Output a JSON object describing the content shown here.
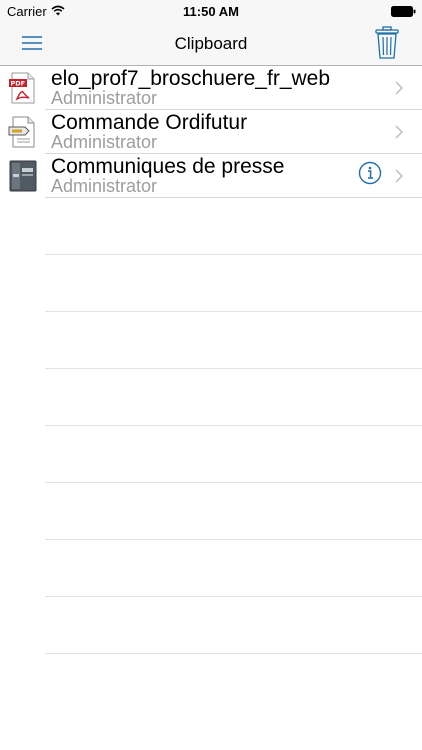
{
  "status_bar": {
    "carrier": "Carrier",
    "time": "11:50 AM",
    "wifi_icon": "wifi-icon",
    "battery_icon": "battery-icon"
  },
  "nav": {
    "title": "Clipboard",
    "menu_icon": "hamburger-menu-icon",
    "trash_icon": "trash-icon"
  },
  "colors": {
    "accent": "#1f6fa8",
    "bar_background": "#f7f7f7",
    "subtitle": "#9e9e9e",
    "separator": "#d9d9d9"
  },
  "items": [
    {
      "title": "elo_prof7_broschuere_fr_web",
      "subtitle": "Administrator",
      "icon": "pdf-file-icon",
      "has_info": false
    },
    {
      "title": "Commande Ordifutur",
      "subtitle": "Administrator",
      "icon": "document-file-icon",
      "has_info": false
    },
    {
      "title": "Communiques de presse",
      "subtitle": "Administrator",
      "icon": "folder-binder-icon",
      "has_info": true
    }
  ]
}
